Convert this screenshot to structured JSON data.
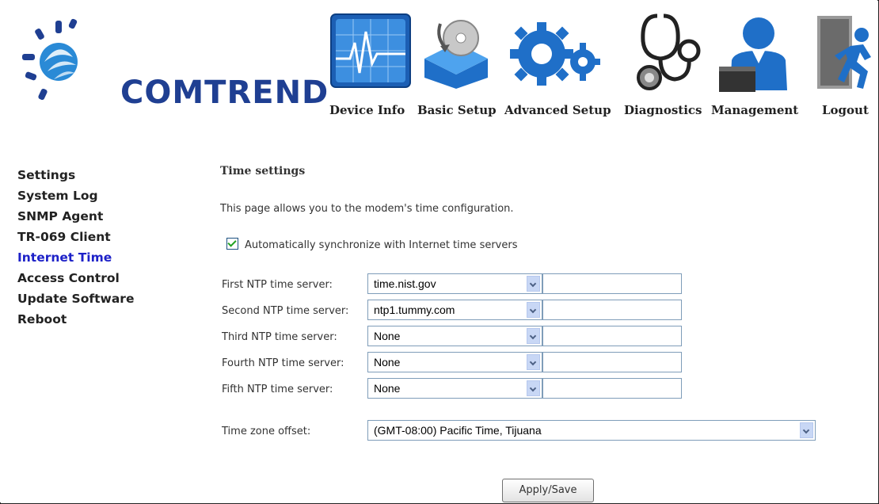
{
  "brand": {
    "name": "COMTREND"
  },
  "nav": [
    {
      "label": "Device Info",
      "icon": "device-info-icon"
    },
    {
      "label": "Basic Setup",
      "icon": "basic-setup-icon"
    },
    {
      "label": "Advanced Setup",
      "icon": "advanced-setup-icon"
    },
    {
      "label": "Diagnostics",
      "icon": "diagnostics-icon"
    },
    {
      "label": "Management",
      "icon": "management-icon"
    },
    {
      "label": "Logout",
      "icon": "logout-icon"
    }
  ],
  "sidebar": {
    "items": [
      {
        "label": "Settings"
      },
      {
        "label": "System Log"
      },
      {
        "label": "SNMP Agent"
      },
      {
        "label": "TR-069 Client"
      },
      {
        "label": "Internet Time",
        "active": true
      },
      {
        "label": "Access Control"
      },
      {
        "label": "Update Software"
      },
      {
        "label": "Reboot"
      }
    ]
  },
  "main": {
    "title": "Time settings",
    "description": "This page allows you to the modem's time configuration.",
    "auto_sync": {
      "label": "Automatically synchronize with Internet time servers",
      "checked": true
    },
    "ntp_servers": [
      {
        "label": "First NTP time server:",
        "value": "time.nist.gov",
        "custom": ""
      },
      {
        "label": "Second NTP time server:",
        "value": "ntp1.tummy.com",
        "custom": ""
      },
      {
        "label": "Third NTP time server:",
        "value": "None",
        "custom": ""
      },
      {
        "label": "Fourth NTP time server:",
        "value": "None",
        "custom": ""
      },
      {
        "label": "Fifth NTP time server:",
        "value": "None",
        "custom": ""
      }
    ],
    "timezone": {
      "label": "Time zone offset:",
      "value": "(GMT-08:00) Pacific Time, Tijuana"
    },
    "apply_label": "Apply/Save"
  },
  "colors": {
    "brand_blue": "#1f3f92",
    "active_link": "#1d21c8",
    "selected_tab_bg": "#2a6fc0"
  }
}
